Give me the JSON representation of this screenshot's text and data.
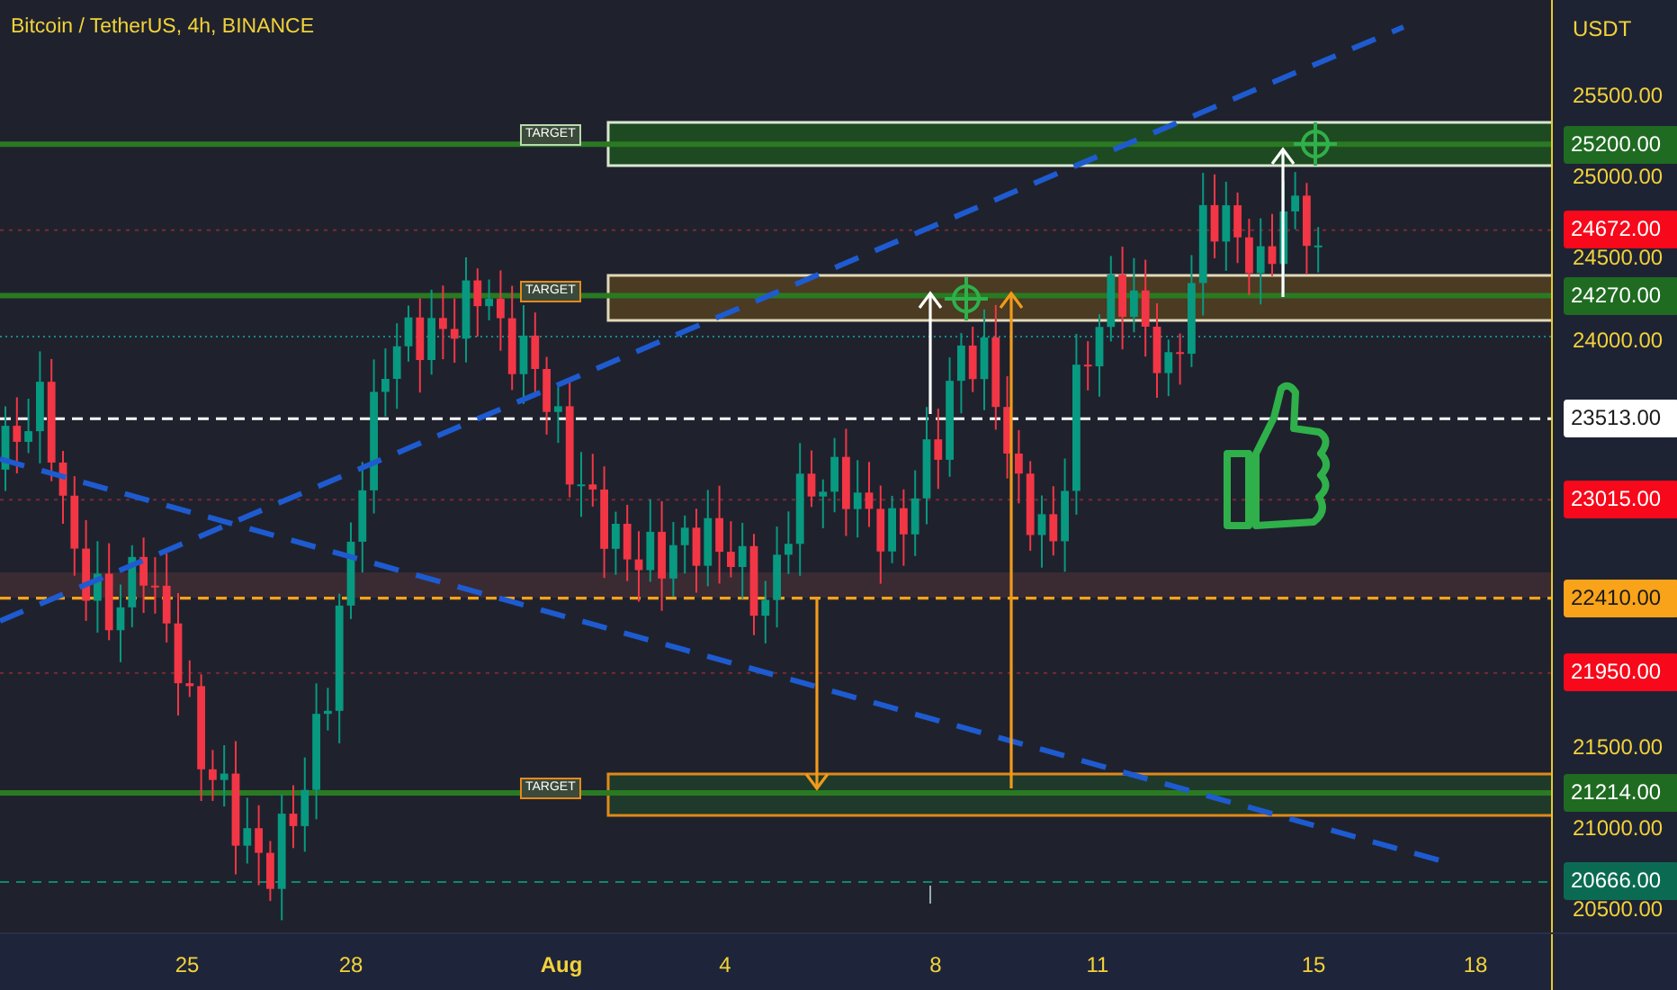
{
  "header": {
    "title": "Bitcoin / TetherUS, 4h, BINANCE"
  },
  "price_axis": {
    "unit": "USDT",
    "ticks": [
      "25500.00",
      "25000.00",
      "24500.00",
      "24000.00",
      "21500.00",
      "21000.00",
      "20500.00"
    ]
  },
  "price_labels": [
    {
      "text": "25200.00",
      "color": "#1f6b21"
    },
    {
      "text": "24672.00",
      "color": "#f7081a"
    },
    {
      "text": "24270.00",
      "color": "#1f6b21"
    },
    {
      "text": "23513.00",
      "color": "#ffffff"
    },
    {
      "text": "23015.00",
      "color": "#f7081a"
    },
    {
      "text": "22410.00",
      "color": "#f9a31a"
    },
    {
      "text": "21950.00",
      "color": "#f7081a"
    },
    {
      "text": "21214.00",
      "color": "#1f6b21"
    },
    {
      "text": "20666.00",
      "color": "#0b6b52"
    }
  ],
  "target_labels": [
    {
      "text": "TARGET",
      "color": "#b9d9b0"
    },
    {
      "text": "TARGET",
      "color": "#e8891a"
    },
    {
      "text": "TARGET",
      "color": "#e8891a"
    }
  ],
  "time_axis": {
    "ticks": [
      "25",
      "28",
      "Aug",
      "4",
      "8",
      "11",
      "15",
      "18"
    ]
  }
}
